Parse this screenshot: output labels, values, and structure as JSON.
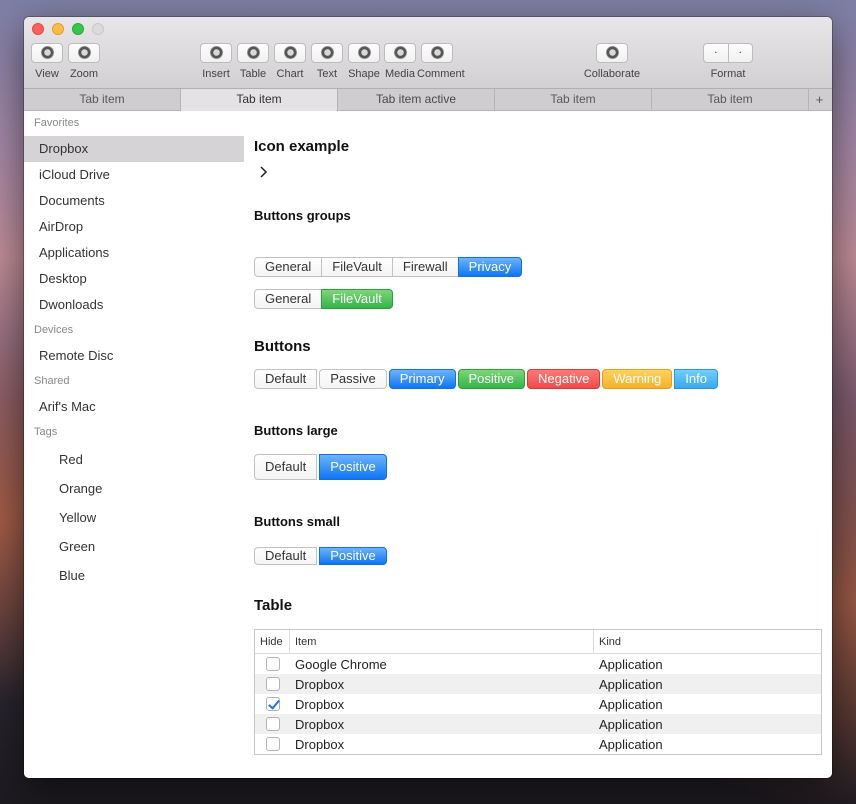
{
  "toolbar": {
    "view": "View",
    "zoom": "Zoom",
    "insert": "Insert",
    "table": "Table",
    "chart": "Chart",
    "text": "Text",
    "shape": "Shape",
    "media": "Media",
    "comment": "Comment",
    "collaborate": "Collaborate",
    "format": "Format",
    "format_left": ".",
    "format_right": "."
  },
  "tabs": [
    "Tab item",
    "Tab item",
    "Tab item active",
    "Tab item",
    "Tab item"
  ],
  "tab_add": "+",
  "sidebar": {
    "favorites_label": "Favorites",
    "favorites": [
      "Dropbox",
      "iCloud Drive",
      "Documents",
      "AirDrop",
      "Applications",
      "Desktop",
      "Dwonloads"
    ],
    "devices_label": "Devices",
    "devices": [
      "Remote Disc"
    ],
    "shared_label": "Shared",
    "shared": [
      "Arif's Mac"
    ],
    "tags_label": "Tags",
    "tags": [
      "Red",
      "Orange",
      "Yellow",
      "Green",
      "Blue"
    ]
  },
  "content": {
    "icon_example_title": "Icon example",
    "button_groups_title": "Buttons groups",
    "group1": [
      "General",
      "FileVault",
      "Firewall",
      "Privacy"
    ],
    "group2": [
      "General",
      "FileVault"
    ],
    "buttons_title": "Buttons",
    "buttons": [
      "Default",
      "Passive",
      "Primary",
      "Positive",
      "Negative",
      "Warning",
      "Info"
    ],
    "buttons_large_title": "Buttons large",
    "buttons_large": [
      "Default",
      "Positive"
    ],
    "buttons_small_title": "Buttons small",
    "buttons_small": [
      "Default",
      "Positive"
    ],
    "table_title": "Table"
  },
  "table": {
    "columns": [
      "Hide",
      "Item",
      "Kind"
    ],
    "rows": [
      {
        "hide": false,
        "item": "Google Chrome",
        "kind": "Application"
      },
      {
        "hide": false,
        "item": "Dropbox",
        "kind": "Application"
      },
      {
        "hide": true,
        "item": "Dropbox",
        "kind": "Application"
      },
      {
        "hide": false,
        "item": "Dropbox",
        "kind": "Application"
      },
      {
        "hide": false,
        "item": "Dropbox",
        "kind": "Application"
      }
    ]
  },
  "colors": {
    "primary": "#0f75f5",
    "positive": "#34b548",
    "negative": "#f24a4a",
    "warning": "#f7b027",
    "info": "#3aa8ee"
  }
}
